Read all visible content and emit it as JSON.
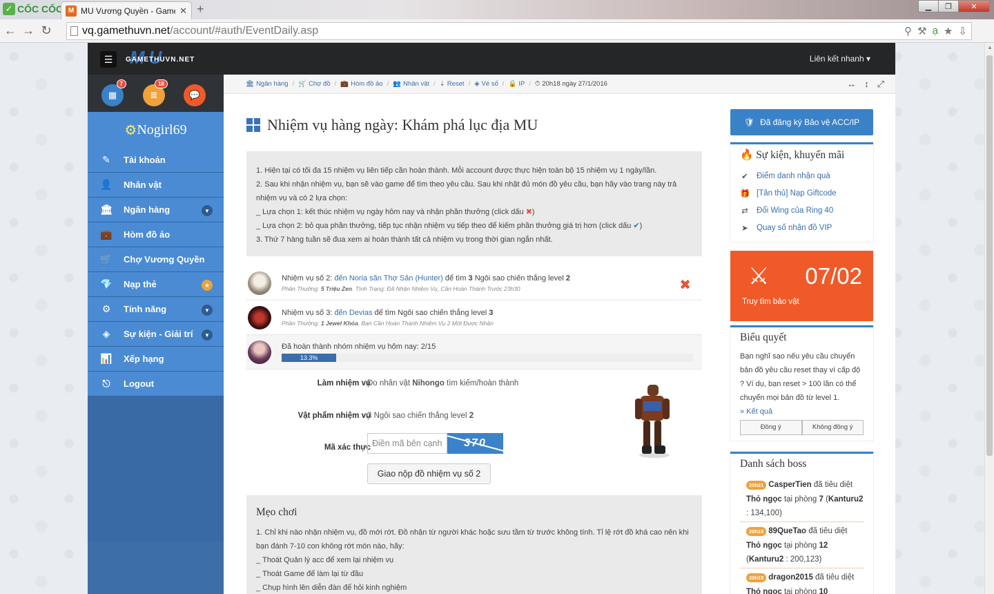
{
  "browser": {
    "brand": "CỐC CỐC",
    "tab_title": "MU Vương Quyền - Game",
    "url_host": "vq.gamethuvn.net",
    "url_path": "/account/#auth/EventDaily.asp"
  },
  "header": {
    "brand_top": "MU",
    "brand_sub": "GAMETHUVN.NET",
    "quick_link": "Liên kết nhanh ▾"
  },
  "sidebar": {
    "badges": {
      "calendar": "7",
      "list": "18"
    },
    "username": "Nogirl69",
    "items": [
      {
        "label": "Tài khoản",
        "icon": "✎"
      },
      {
        "label": "Nhân vật",
        "icon": "👤"
      },
      {
        "label": "Ngân hàng",
        "icon": "🏛"
      },
      {
        "label": "Hòm đồ ảo",
        "icon": "💼"
      },
      {
        "label": "Chợ Vương Quyền",
        "icon": "🛒"
      },
      {
        "label": "Nạp thẻ",
        "icon": "💎"
      },
      {
        "label": "Tính năng",
        "icon": "⚙"
      },
      {
        "label": "Sự kiện - Giải trí",
        "icon": "◈"
      },
      {
        "label": "Xếp hạng",
        "icon": "📊"
      },
      {
        "label": "Logout",
        "icon": "⎋"
      }
    ]
  },
  "breadcrumb": {
    "items": [
      "Ngân hàng",
      "Chợ đồ",
      "Hòm đồ ảo",
      "Nhân vật",
      "Reset",
      "Vé số",
      "IP"
    ],
    "time": "20h18 ngày 27/1/2016"
  },
  "main": {
    "title": "Nhiệm vụ hàng ngày: Khám phá lục địa MU",
    "rules": {
      "l1": "1. Hiện tại có tối đa 15 nhiệm vụ liên tiếp cần hoàn thành. Mỗi account được thực hiện toàn bộ 15 nhiệm vụ 1 ngày/lần.",
      "l2": "2. Sau khi nhận nhiệm vụ, bạn sẽ vào game để tìm theo yêu cầu. Sau khi nhặt đủ món đồ yêu cầu, bạn hãy vào trang này trả nhiệm vụ và có 2 lựa chọn:",
      "l3a": "_ Lựa chọn 1: kết thúc nhiệm vụ ngày hôm nay và nhận phần thưởng (click dấu ",
      "l3b": ")",
      "l4a": "_ Lựa chọn 2: bỏ qua phần thưởng, tiếp tục nhận nhiệm vụ tiếp theo để kiếm phần thưởng giá trị hơn (click dấu ",
      "l4b": ")",
      "l5": "3. Thứ 7 hàng tuần sẽ đua xem ai hoàn thành tất cả nhiệm vụ trong thời gian ngắn nhất."
    },
    "quest2": {
      "prefix": "Nhiệm vụ số 2: ",
      "link": "đến Noria săn Thợ Săn (Hunter)",
      "mid": " để tìm ",
      "qty": "3",
      "item": " Ngôi sao chiến thắng level ",
      "level": "2",
      "reward_label": "Phần Thưởng: ",
      "reward": "5 Triệu Zen",
      "status": ". Tình Trạng: Đã Nhận Nhiệm Vụ, Cần Hoàn Thành Trước 23h30"
    },
    "quest3": {
      "prefix": "Nhiệm vụ số 3: ",
      "link": "đến Devias",
      "mid": " để tìm Ngôi sao chiến thắng level ",
      "level": "3",
      "reward_label": "Phần Thưởng: ",
      "reward": "1 Jewel Khóa",
      "status": ". Bạn Cần Hoàn Thành Nhiệm Vụ 2 Mới Được Nhận"
    },
    "progress": {
      "text": "Đã hoàn thành nhóm nhiệm vụ hôm nay: 2/15",
      "percent_label": "13.3%",
      "percent": 13.3
    },
    "form": {
      "task_label": "Làm nhiệm vụ",
      "task_pre": "Do nhân vật ",
      "task_char": "Nihongo",
      "task_post": " tìm kiếm/hoàn thành",
      "item_label": "Vật phẩm nhiệm vụ",
      "item_value": "3 Ngôi sao chiến thắng level ",
      "item_level": "2",
      "code_label": "Mã xác thực",
      "code_placeholder": "Điền mã bên cạnh",
      "captcha": "370",
      "submit": "Giao nộp đồ nhiệm vụ số 2"
    },
    "tips": {
      "title": "Mẹo chơi",
      "l1": "1. Chỉ khi nào nhận nhiệm vụ, đồ mới rớt. Đồ nhận từ người khác hoặc sưu tầm từ trước không tính. Tỉ lệ rớt đồ khá cao nên khi bạn đánh 7-10 con không rớt món nào, hãy:",
      "l2": "_ Thoát Quản lý acc để xem lại nhiệm vụ",
      "l3": "_ Thoát Game để làm lại từ đầu",
      "l4": "_ Chụp hình lên diễn đàn để hỏi kinh nghiệm"
    }
  },
  "right": {
    "protect": "Đã đăng ký Bảo vệ ACC/IP",
    "events_title": "Sự kiện, khuyến mãi",
    "events": [
      "Điểm danh nhận quà",
      "[Tân thủ] Nạp Giftcode",
      "Đổi Wing của Ring 40",
      "Quay số nhận đồ VIP"
    ],
    "treasure_date": "07/02",
    "treasure_label": "Truy tìm bảo vật",
    "poll_title": "Biểu quyết",
    "poll_text": "Bạn nghĩ sao nếu yêu cầu chuyển bản đồ yêu cầu reset thay vì cấp độ ? Ví dụ, bạn reset > 100 lần có thể chuyển mọi bản đồ từ level 1.",
    "poll_result": "» Kết quả",
    "poll_yes": "Đồng ý",
    "poll_no": "Không đồng ý",
    "boss_title": "Danh sách boss",
    "bosses": [
      {
        "time": "20h21",
        "player": "CasperTien",
        "killed": " đã tiêu diệt ",
        "boss": "Thỏ ngọc",
        "room_pre": " tại phòng ",
        "room": "7",
        "map": "Kanturu2",
        "coords": " : 134,100)"
      },
      {
        "time": "20h15",
        "player": "89QueTao",
        "killed": " đã tiêu diệt ",
        "boss": "Thỏ ngọc",
        "room_pre": " tại phòng ",
        "room": "12",
        "map": "Kanturu2",
        "coords": " : 200,123)"
      },
      {
        "time": "20h15",
        "player": "dragon2015",
        "killed": " đã tiêu diệt ",
        "boss": "Thỏ ngọc",
        "room_pre": " tại phòng ",
        "room": "10",
        "map": "",
        "coords": ""
      }
    ]
  },
  "colors": {
    "accent": "#3a82c8",
    "sidebar": "#4a8bd4",
    "orange": "#f05a28",
    "dark": "#242628"
  }
}
